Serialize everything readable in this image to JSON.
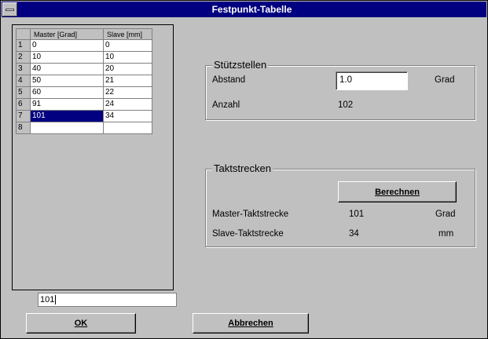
{
  "window": {
    "title": "Festpunkt-Tabelle"
  },
  "table": {
    "columns": [
      "Master [Grad]",
      "Slave [mm]"
    ],
    "rows": [
      {
        "num": "1",
        "master": "0",
        "slave": "0"
      },
      {
        "num": "2",
        "master": "10",
        "slave": "10"
      },
      {
        "num": "3",
        "master": "40",
        "slave": "20"
      },
      {
        "num": "4",
        "master": "50",
        "slave": "21"
      },
      {
        "num": "5",
        "master": "60",
        "slave": "22"
      },
      {
        "num": "6",
        "master": "91",
        "slave": "24"
      },
      {
        "num": "7",
        "master": "101",
        "slave": "34"
      },
      {
        "num": "8",
        "master": "",
        "slave": ""
      }
    ],
    "selected_row": "7"
  },
  "edit_field": {
    "value": "101"
  },
  "stuetzstellen": {
    "title": "Stützstellen",
    "abstand_label": "Abstand",
    "abstand_value": "1.0",
    "abstand_unit": "Grad",
    "anzahl_label": "Anzahl",
    "anzahl_value": "102"
  },
  "taktstrecken": {
    "title": "Taktstrecken",
    "berechnen_label": "Berechnen",
    "master_label": "Master-Taktstrecke",
    "master_value": "101",
    "master_unit": "Grad",
    "slave_label": "Slave-Taktstrecke",
    "slave_value": "34",
    "slave_unit": "mm"
  },
  "buttons": {
    "ok": "OK",
    "abbrechen": "Abbrechen"
  }
}
